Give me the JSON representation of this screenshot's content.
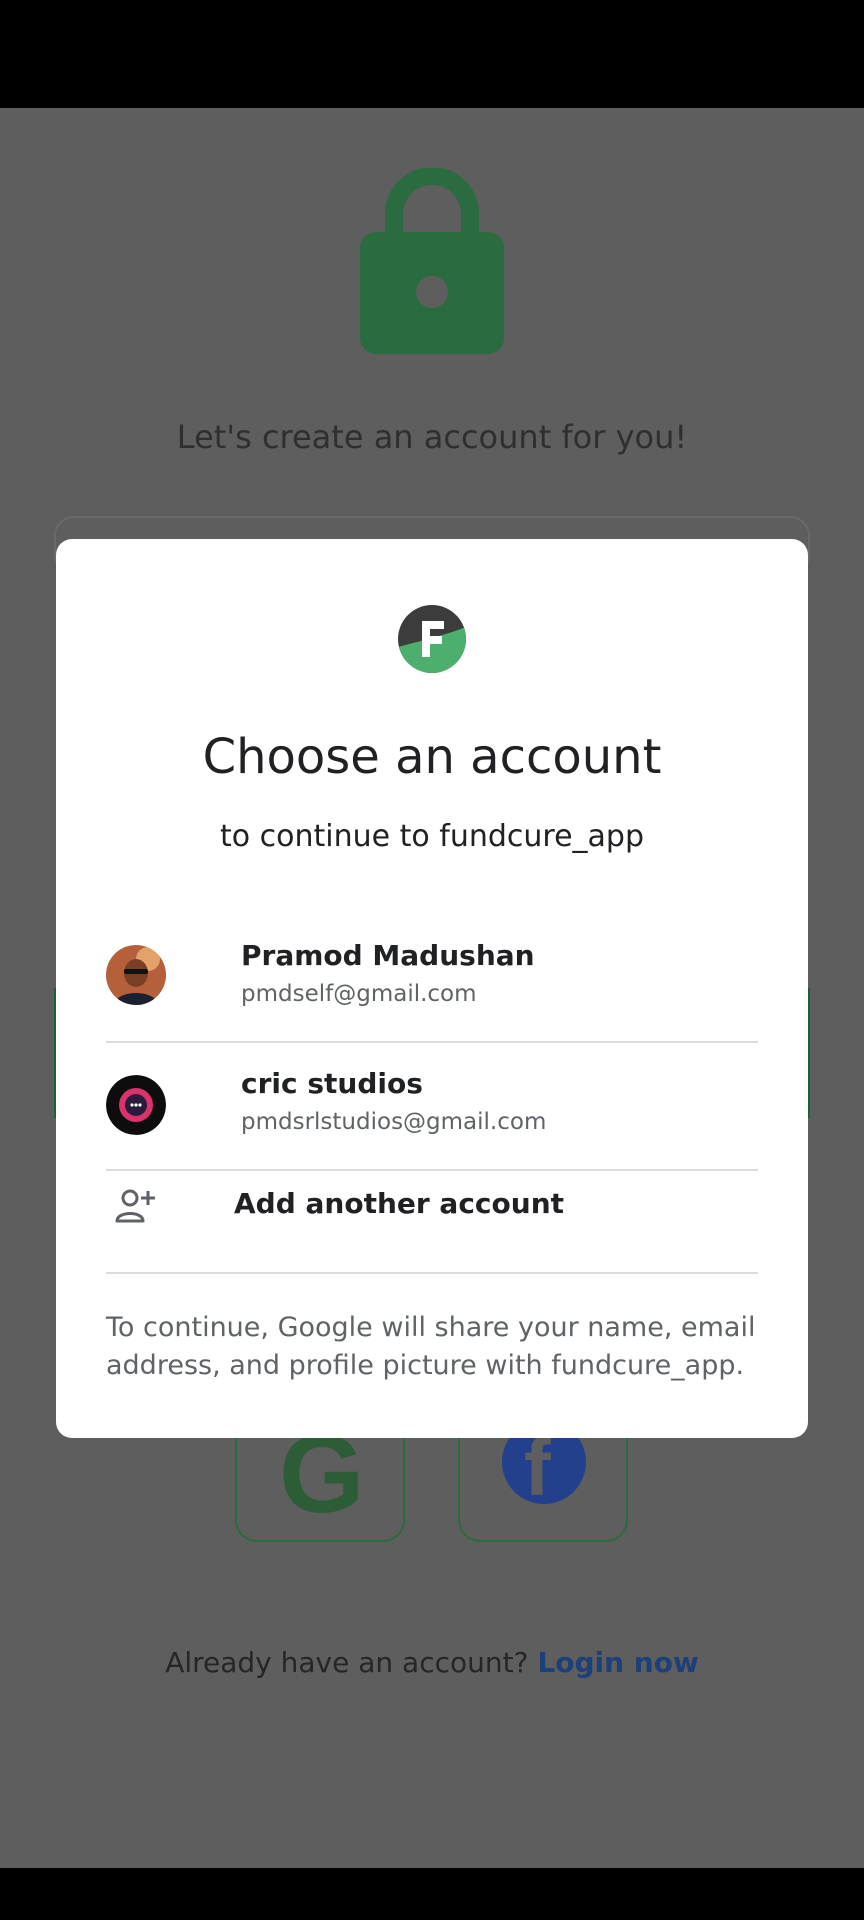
{
  "background": {
    "headline": "Let's create an account for you!",
    "login_prompt": "Already have an account?",
    "login_link": "Login now",
    "social": [
      "google",
      "facebook"
    ]
  },
  "dialog": {
    "title": "Choose an account",
    "subtitle": "to continue to fundcure_app",
    "accounts": [
      {
        "name": "Pramod Madushan",
        "email": "pmdself@gmail.com"
      },
      {
        "name": "cric studios",
        "email": "pmdsrlstudios@gmail.com"
      }
    ],
    "add_account_label": "Add another account",
    "disclaimer": "To continue, Google will share your name, email address, and profile picture with fundcure_app."
  },
  "colors": {
    "scrim": "#5e5e5e",
    "brand_green": "#4caf6e",
    "logo_dark": "#3c3c3c",
    "link_blue": "#1a73e8"
  }
}
